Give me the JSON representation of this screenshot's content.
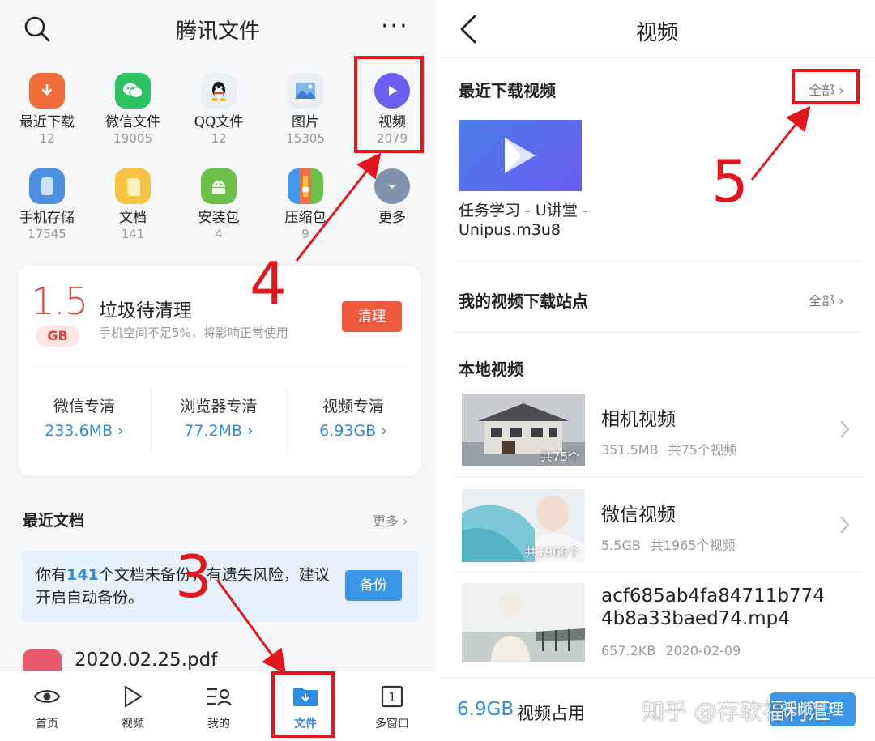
{
  "left": {
    "header": {
      "title": "腾讯文件",
      "more_glyph": "···"
    },
    "categories": [
      {
        "name": "最近下载",
        "count": "12",
        "color": "#f26b3a",
        "icon": "download-icon"
      },
      {
        "name": "微信文件",
        "count": "19005",
        "color": "#2dc262",
        "icon": "wechat-icon"
      },
      {
        "name": "QQ文件",
        "count": "12",
        "color": "#eceff3",
        "icon": "qq-icon"
      },
      {
        "name": "图片",
        "count": "15305",
        "color": "#e9eef5",
        "icon": "image-icon"
      },
      {
        "name": "视频",
        "count": "2079",
        "color": "#6b5ef0",
        "icon": "video-play-icon"
      },
      {
        "name": "手机存储",
        "count": "17545",
        "color": "#4f8fe0",
        "icon": "phone-storage-icon"
      },
      {
        "name": "文档",
        "count": "141",
        "color": "#f6c343",
        "icon": "document-icon"
      },
      {
        "name": "安装包",
        "count": "4",
        "color": "#6dc14a",
        "icon": "android-icon"
      },
      {
        "name": "压缩包",
        "count": "9",
        "color": "#f0704a",
        "icon": "archive-icon"
      },
      {
        "name": "更多",
        "count": "",
        "color": "#7f93ad",
        "icon": "chevron-down-icon"
      }
    ],
    "cleanup": {
      "size": "1.5",
      "unit": "GB",
      "title": "垃圾待清理",
      "subtitle": "手机空间不足5%，将影响正常使用",
      "button": "清理",
      "items": [
        {
          "label": "微信专清",
          "value": "233.6MB"
        },
        {
          "label": "浏览器专清",
          "value": "77.2MB"
        },
        {
          "label": "视频专清",
          "value": "6.93GB"
        }
      ]
    },
    "recent_docs": {
      "title": "最近文档",
      "more": "更多",
      "backup_prefix": "你有",
      "backup_count": "141",
      "backup_suffix": "个文档未备份，有遗失风险，建议开启自动备份。",
      "backup_button": "备份",
      "doc_name": "2020.02.25.pdf"
    },
    "nav": [
      {
        "label": "首页",
        "icon": "eye-icon"
      },
      {
        "label": "视频",
        "icon": "play-outline-icon"
      },
      {
        "label": "我的",
        "icon": "user-list-icon"
      },
      {
        "label": "文件",
        "icon": "folder-download-icon",
        "active": true
      },
      {
        "label": "多窗口",
        "icon": "multi-window-icon",
        "badge": "1"
      }
    ]
  },
  "right": {
    "header": {
      "title": "视频"
    },
    "recent": {
      "title": "最近下载视频",
      "all": "全部",
      "name": "任务学习 - U讲堂 - Unipus.m3u8"
    },
    "sites": {
      "title": "我的视频下载站点",
      "all": "全部"
    },
    "local": {
      "title": "本地视频",
      "items": [
        {
          "title": "相机视频",
          "size": "351.5MB",
          "count": "共75个视频",
          "thumb_count": "共75个"
        },
        {
          "title": "微信视频",
          "size": "5.5GB",
          "count": "共1965个视频",
          "thumb_count": "共1965个"
        },
        {
          "title": "acf685ab4fa84711b7744b8a33baed74.mp4",
          "size": "657.2KB",
          "date": "2020-02-09"
        }
      ]
    },
    "bottom": {
      "usage_value": "6.9GB",
      "usage_label": "视频占用",
      "manage_button": "视频管理",
      "watermark": "知乎 @存软福利汇"
    }
  },
  "annotations": {
    "step3": "3",
    "step4": "4",
    "step5": "5",
    "color": "#e3161d"
  }
}
